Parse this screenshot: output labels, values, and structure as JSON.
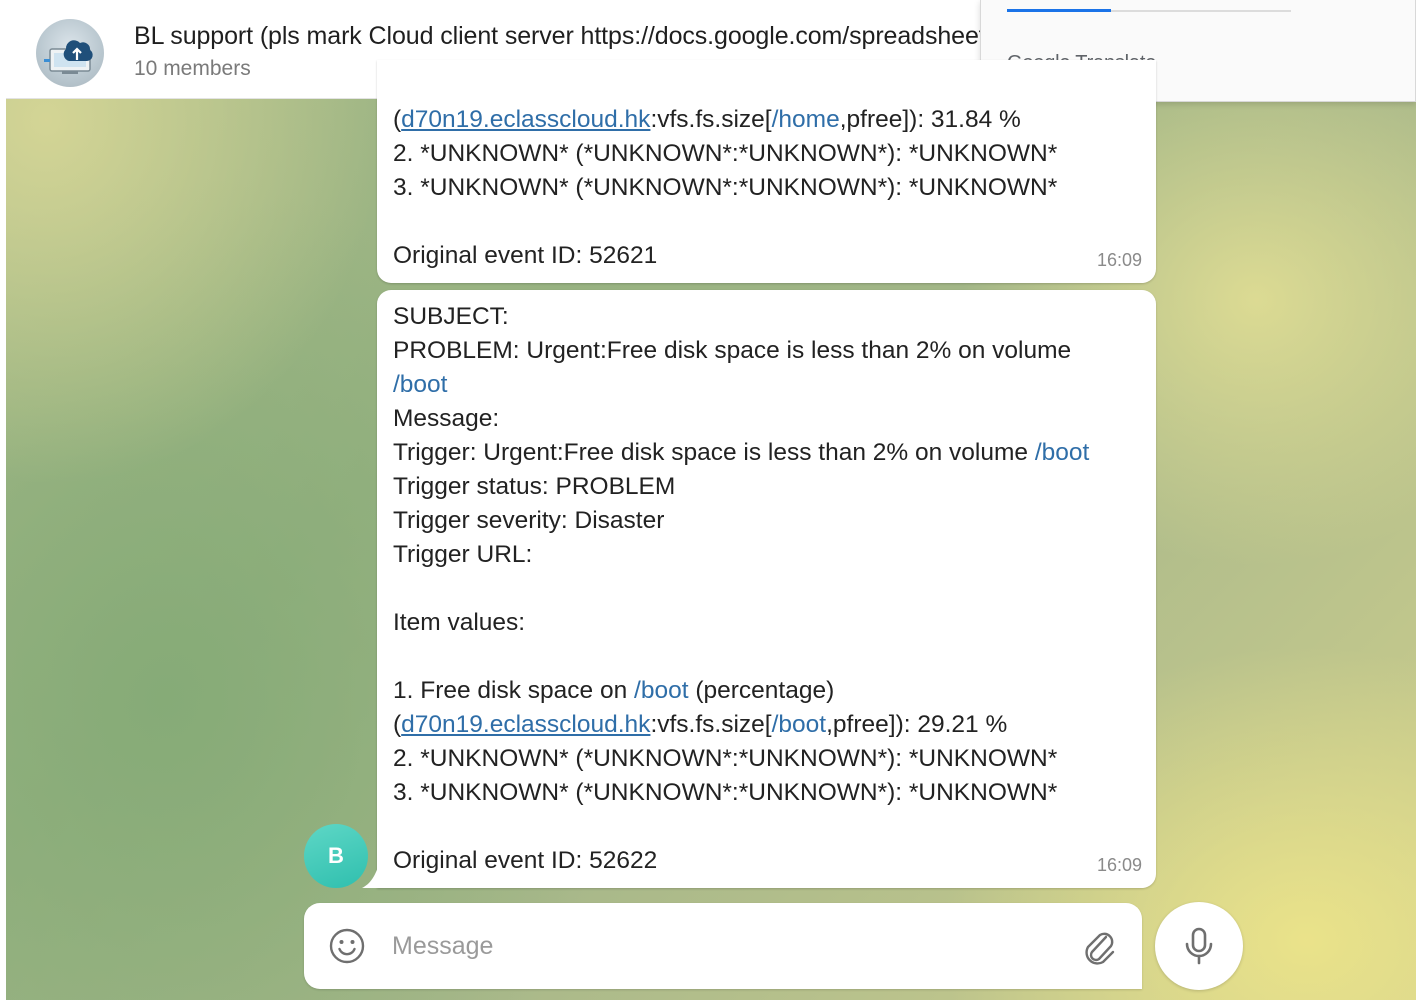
{
  "header": {
    "title": "BL support (pls mark Cloud client server https://docs.google.com/spreadsheets",
    "members": "10 members",
    "avatar_icon": "cloud-upload-icon"
  },
  "translate_popup": {
    "label_google": "Google",
    "label_translate": " Translate",
    "accent_color": "#1a73e8"
  },
  "messages": [
    {
      "partial_top": true,
      "lines": [
        [
          {
            "t": "("
          },
          {
            "t": "d70n19.eclasscloud.hk",
            "k": "ulink"
          },
          {
            "t": ":vfs.fs.size["
          },
          {
            "t": "/home",
            "k": "link"
          },
          {
            "t": ",pfree]): 31.84 %"
          }
        ],
        [
          {
            "t": "2. *UNKNOWN* (*UNKNOWN*:*UNKNOWN*): *UNKNOWN*"
          }
        ],
        [
          {
            "t": "3. *UNKNOWN* (*UNKNOWN*:*UNKNOWN*): *UNKNOWN*"
          }
        ],
        [],
        [
          {
            "t": "Original event ID: 52621"
          }
        ]
      ],
      "time": "16:09"
    },
    {
      "lines": [
        [
          {
            "t": "SUBJECT:"
          }
        ],
        [
          {
            "t": "PROBLEM: Urgent:Free disk space is less than 2% on volume"
          }
        ],
        [
          {
            "t": "/boot",
            "k": "link"
          }
        ],
        [
          {
            "t": "Message:"
          }
        ],
        [
          {
            "t": "Trigger: Urgent:Free disk space is less than 2% on volume "
          },
          {
            "t": "/boot",
            "k": "link"
          }
        ],
        [
          {
            "t": "Trigger status: PROBLEM"
          }
        ],
        [
          {
            "t": "Trigger severity: Disaster"
          }
        ],
        [
          {
            "t": "Trigger URL:"
          }
        ],
        [],
        [
          {
            "t": "Item values:"
          }
        ],
        [],
        [
          {
            "t": "1. Free disk space on "
          },
          {
            "t": "/boot",
            "k": "link"
          },
          {
            "t": " (percentage)"
          }
        ],
        [
          {
            "t": "("
          },
          {
            "t": "d70n19.eclasscloud.hk",
            "k": "ulink"
          },
          {
            "t": ":vfs.fs.size["
          },
          {
            "t": "/boot",
            "k": "link"
          },
          {
            "t": ",pfree]): 29.21 %"
          }
        ],
        [
          {
            "t": "2. *UNKNOWN* (*UNKNOWN*:*UNKNOWN*): *UNKNOWN*"
          }
        ],
        [
          {
            "t": "3. *UNKNOWN* (*UNKNOWN*:*UNKNOWN*): *UNKNOWN*"
          }
        ],
        [],
        [
          {
            "t": "Original event ID: 52622"
          }
        ]
      ],
      "time": "16:09"
    }
  ],
  "sender_avatar": {
    "initial": "B",
    "color": "#2fbfae"
  },
  "composer": {
    "placeholder": "Message",
    "emoji_icon": "smile-icon",
    "attach_icon": "paperclip-icon",
    "mic_icon": "microphone-icon"
  },
  "colors": {
    "link": "#2f6ea8",
    "accent": "#1a73e8"
  }
}
